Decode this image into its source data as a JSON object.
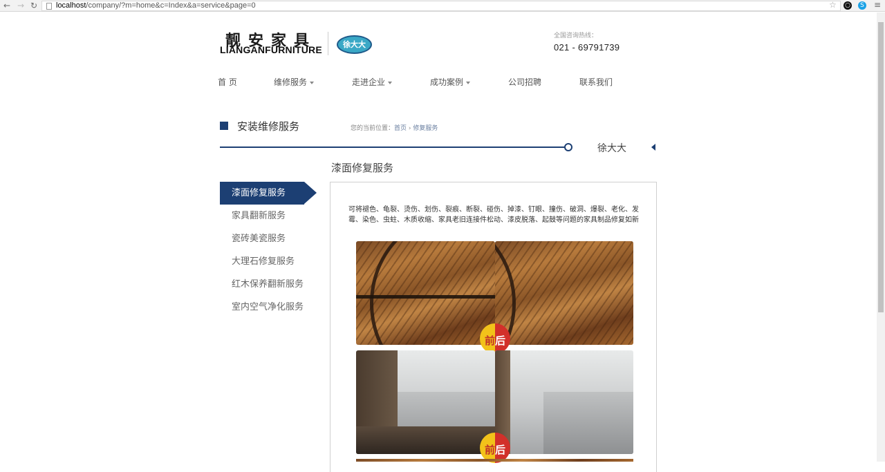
{
  "browser": {
    "url_prefix": "localhost",
    "url_rest": "/company/?m=home&c=Index&a=service&page=0",
    "back_icon": "arrow-left-icon",
    "forward_icon": "arrow-right-icon",
    "reload_icon": "reload-icon"
  },
  "header": {
    "logo_cn": "靓安家具",
    "logo_en": "LIANGANFURNITURE",
    "brand_badge": "徐大大",
    "hotline_label": "全国咨询热线：",
    "hotline_number": "021 - 69791739"
  },
  "nav": {
    "items": [
      {
        "label": "首 页",
        "dropdown": false
      },
      {
        "label": "维修服务",
        "dropdown": true
      },
      {
        "label": "走进企业",
        "dropdown": true
      },
      {
        "label": "成功案例",
        "dropdown": true
      },
      {
        "label": "公司招聘",
        "dropdown": false
      },
      {
        "label": "联系我们",
        "dropdown": false
      }
    ]
  },
  "section": {
    "title": "安装维修服务",
    "breadcrumb_prefix": "您的当前位置：",
    "breadcrumb_home": "首页",
    "breadcrumb_sep": " › ",
    "breadcrumb_current": "修复服务",
    "side_name": "徐大大"
  },
  "sidebar": {
    "items": [
      {
        "label": "漆面修复服务",
        "active": true
      },
      {
        "label": "家具翻新服务",
        "active": false
      },
      {
        "label": "瓷砖美瓷服务",
        "active": false
      },
      {
        "label": "大理石修复服务",
        "active": false
      },
      {
        "label": "红木保养翻新服务",
        "active": false
      },
      {
        "label": "室内空气净化服务",
        "active": false
      }
    ]
  },
  "content": {
    "title": "漆面修复服务",
    "description": "可将褪色、龟裂、烫伤、划伤、裂痕、断裂、碰伤、掉漆、钉眼、撞伤、破洞、爆裂、老化、发霉、染色、虫蛀、木质收缩、家具老旧连接件松动、漆皮脱落、起鼓等问题的家具制品修复如新",
    "badge_before": "前",
    "badge_after": "后"
  },
  "colors": {
    "accent": "#1c3f73",
    "badge_yellow": "#f2c21a",
    "badge_red": "#d2302a"
  }
}
